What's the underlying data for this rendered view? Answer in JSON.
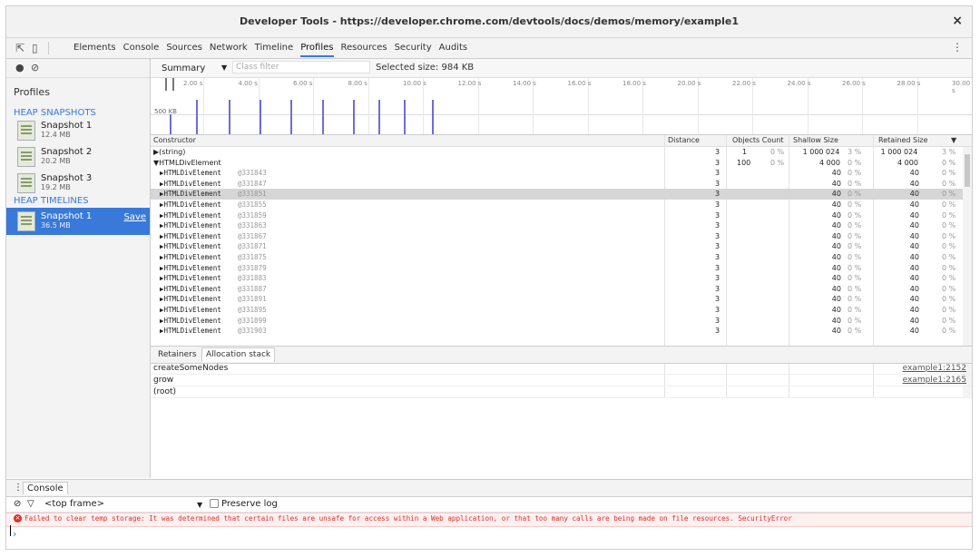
{
  "window": {
    "title": "Developer Tools - https://developer.chrome.com/devtools/docs/demos/memory/example1",
    "close_glyph": "×"
  },
  "tabs": [
    "Elements",
    "Console",
    "Sources",
    "Network",
    "Timeline",
    "Profiles",
    "Resources",
    "Security",
    "Audits"
  ],
  "active_tab": "Profiles",
  "sidebar": {
    "title": "Profiles",
    "heap_snapshots_label": "HEAP SNAPSHOTS",
    "heap_timelines_label": "HEAP TIMELINES",
    "snapshots": [
      {
        "name": "Snapshot 1",
        "size": "12.4 MB"
      },
      {
        "name": "Snapshot 2",
        "size": "20.2 MB"
      },
      {
        "name": "Snapshot 3",
        "size": "19.2 MB"
      }
    ],
    "timeline_snapshot": {
      "name": "Snapshot 1",
      "size": "36.5 MB",
      "save_label": "Save"
    }
  },
  "toolbar": {
    "view": "Summary",
    "class_filter_placeholder": "Class filter",
    "selected_size": "Selected size: 984 KB"
  },
  "timeline": {
    "ticks": [
      "2.00 s",
      "4.00 s",
      "6.00 s",
      "8.00 s",
      "10.00 s",
      "12.00 s",
      "14.00 s",
      "16.00 s",
      "18.00 s",
      "20.00 s",
      "22.00 s",
      "24.00 s",
      "26.00 s",
      "28.00 s",
      "30.00 s"
    ],
    "scale_label": "500 KB"
  },
  "columns": {
    "constructor": "Constructor",
    "distance": "Distance",
    "objects_count": "Objects Count",
    "shallow_size": "Shallow Size",
    "retained_size": "Retained Size",
    "sort_glyph": "▼"
  },
  "rows": [
    {
      "constructor": "▶(string)",
      "distance": "3",
      "objects": "1",
      "objects_pct": "0 %",
      "shallow": "1 000 024",
      "shallow_pct": "3 %",
      "retained": "1 000 024",
      "retained_pct": "3 %",
      "mono": false
    },
    {
      "constructor": "▼HTMLDivElement",
      "distance": "3",
      "objects": "100",
      "objects_pct": "0 %",
      "shallow": "4 000",
      "shallow_pct": "0 %",
      "retained": "4 000",
      "retained_pct": "0 %",
      "mono": false
    },
    {
      "constructor": "▶HTMLDivElement",
      "id": "@331843",
      "distance": "3",
      "shallow": "40",
      "shallow_pct": "0 %",
      "retained": "40",
      "retained_pct": "0 %",
      "mono": true
    },
    {
      "constructor": "▶HTMLDivElement",
      "id": "@331847",
      "distance": "3",
      "shallow": "40",
      "shallow_pct": "0 %",
      "retained": "40",
      "retained_pct": "0 %",
      "mono": true
    },
    {
      "constructor": "▶HTMLDivElement",
      "id": "@331851",
      "distance": "3",
      "shallow": "40",
      "shallow_pct": "0 %",
      "retained": "40",
      "retained_pct": "0 %",
      "mono": true,
      "selected": true
    },
    {
      "constructor": "▶HTMLDivElement",
      "id": "@331855",
      "distance": "3",
      "shallow": "40",
      "shallow_pct": "0 %",
      "retained": "40",
      "retained_pct": "0 %",
      "mono": true
    },
    {
      "constructor": "▶HTMLDivElement",
      "id": "@331859",
      "distance": "3",
      "shallow": "40",
      "shallow_pct": "0 %",
      "retained": "40",
      "retained_pct": "0 %",
      "mono": true
    },
    {
      "constructor": "▶HTMLDivElement",
      "id": "@331863",
      "distance": "3",
      "shallow": "40",
      "shallow_pct": "0 %",
      "retained": "40",
      "retained_pct": "0 %",
      "mono": true
    },
    {
      "constructor": "▶HTMLDivElement",
      "id": "@331867",
      "distance": "3",
      "shallow": "40",
      "shallow_pct": "0 %",
      "retained": "40",
      "retained_pct": "0 %",
      "mono": true
    },
    {
      "constructor": "▶HTMLDivElement",
      "id": "@331871",
      "distance": "3",
      "shallow": "40",
      "shallow_pct": "0 %",
      "retained": "40",
      "retained_pct": "0 %",
      "mono": true
    },
    {
      "constructor": "▶HTMLDivElement",
      "id": "@331875",
      "distance": "3",
      "shallow": "40",
      "shallow_pct": "0 %",
      "retained": "40",
      "retained_pct": "0 %",
      "mono": true
    },
    {
      "constructor": "▶HTMLDivElement",
      "id": "@331879",
      "distance": "3",
      "shallow": "40",
      "shallow_pct": "0 %",
      "retained": "40",
      "retained_pct": "0 %",
      "mono": true
    },
    {
      "constructor": "▶HTMLDivElement",
      "id": "@331883",
      "distance": "3",
      "shallow": "40",
      "shallow_pct": "0 %",
      "retained": "40",
      "retained_pct": "0 %",
      "mono": true
    },
    {
      "constructor": "▶HTMLDivElement",
      "id": "@331887",
      "distance": "3",
      "shallow": "40",
      "shallow_pct": "0 %",
      "retained": "40",
      "retained_pct": "0 %",
      "mono": true
    },
    {
      "constructor": "▶HTMLDivElement",
      "id": "@331891",
      "distance": "3",
      "shallow": "40",
      "shallow_pct": "0 %",
      "retained": "40",
      "retained_pct": "0 %",
      "mono": true
    },
    {
      "constructor": "▶HTMLDivElement",
      "id": "@331895",
      "distance": "3",
      "shallow": "40",
      "shallow_pct": "0 %",
      "retained": "40",
      "retained_pct": "0 %",
      "mono": true
    },
    {
      "constructor": "▶HTMLDivElement",
      "id": "@331899",
      "distance": "3",
      "shallow": "40",
      "shallow_pct": "0 %",
      "retained": "40",
      "retained_pct": "0 %",
      "mono": true
    },
    {
      "constructor": "▶HTMLDivElement",
      "id": "@331903",
      "distance": "3",
      "shallow": "40",
      "shallow_pct": "0 %",
      "retained": "40",
      "retained_pct": "0 %",
      "mono": true
    }
  ],
  "retainer_tabs": [
    "Retainers",
    "Allocation stack"
  ],
  "active_retainer_tab": "Allocation stack",
  "allocation_stack": [
    {
      "fn": "createSomeNodes",
      "loc": "example1:2152"
    },
    {
      "fn": "grow",
      "loc": "example1:2165"
    },
    {
      "fn": "(root)",
      "loc": ""
    }
  ],
  "drawer": {
    "tab": "Console",
    "context": "<top frame>",
    "preserve_log": "Preserve log",
    "error": "Failed to clear temp storage: It was determined that certain files are unsafe for access within a Web application, or that too many calls are being made on file resources. SecurityError",
    "prompt": "›"
  }
}
